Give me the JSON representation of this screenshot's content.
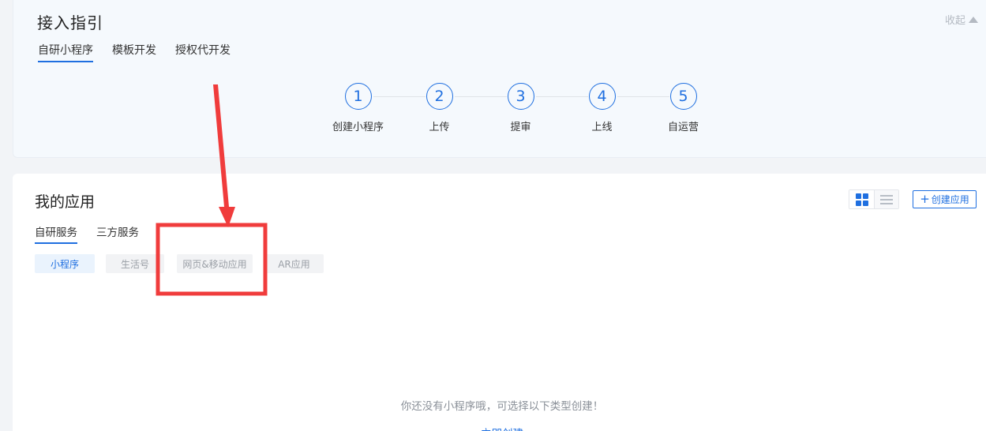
{
  "guide": {
    "title": "接入指引",
    "collapse_label": "收起",
    "tabs": [
      {
        "label": "自研小程序",
        "active": true
      },
      {
        "label": "模板开发",
        "active": false
      },
      {
        "label": "授权代开发",
        "active": false
      }
    ],
    "steps": [
      {
        "number": "1",
        "label": "创建小程序"
      },
      {
        "number": "2",
        "label": "上传"
      },
      {
        "number": "3",
        "label": "提审"
      },
      {
        "number": "4",
        "label": "上线"
      },
      {
        "number": "5",
        "label": "自运营"
      }
    ]
  },
  "apps": {
    "title": "我的应用",
    "create_label": "创建应用",
    "view_icons": [
      "grid-view-icon",
      "list-view-icon"
    ],
    "tabs": [
      {
        "label": "自研服务",
        "active": true
      },
      {
        "label": "三方服务",
        "active": false
      }
    ],
    "chips": [
      {
        "label": "小程序",
        "active": true
      },
      {
        "label": "生活号",
        "active": false
      },
      {
        "label": "网页&移动应用",
        "active": false
      },
      {
        "label": "AR应用",
        "active": false
      }
    ],
    "empty_text": "你还没有小程序哦，可选择以下类型创建！",
    "empty_link": "立即创建"
  },
  "colors": {
    "accent": "#1f6fe0",
    "annotation": "#f03c3c"
  }
}
